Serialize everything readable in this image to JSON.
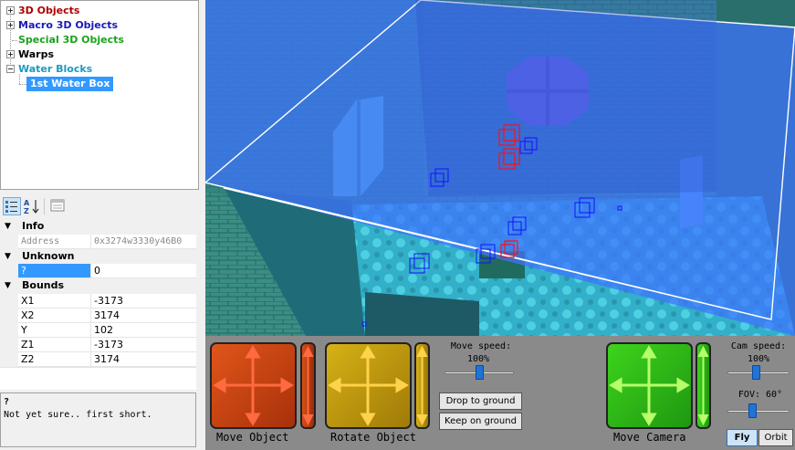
{
  "tree": {
    "items": [
      {
        "label": "3D Objects",
        "color": "#b00000",
        "expander": "plus"
      },
      {
        "label": "Macro 3D Objects",
        "color": "#1a1ab8",
        "expander": "plus"
      },
      {
        "label": "Special 3D Objects",
        "color": "#1aa31a",
        "expander": "none"
      },
      {
        "label": "Warps",
        "color": "#000000",
        "expander": "plus"
      },
      {
        "label": "Water Blocks",
        "color": "#1a9bbf",
        "expander": "minus"
      }
    ],
    "selected_child": "1st Water Box"
  },
  "toolbar": {
    "icons": [
      "categorized-icon",
      "alphabetical-sort-icon",
      "property-pages-icon"
    ]
  },
  "properties": {
    "info": {
      "title": "Info",
      "address_label": "Address",
      "address_value": "0x3274w3330y46B0"
    },
    "unknown": {
      "title": "Unknown",
      "field_label": "?",
      "field_value": "0"
    },
    "bounds": {
      "title": "Bounds",
      "rows": [
        {
          "name": "X1",
          "value": "-3173"
        },
        {
          "name": "X2",
          "value": "3174"
        },
        {
          "name": "Y",
          "value": "102"
        },
        {
          "name": "Z1",
          "value": "-3173"
        },
        {
          "name": "Z2",
          "value": "3174"
        }
      ]
    }
  },
  "description": {
    "title": "?",
    "text": "Not yet sure.. first short."
  },
  "controls": {
    "move_object_label": "Move Object",
    "rotate_object_label": "Rotate Object",
    "move_camera_label": "Move Camera",
    "move_speed_label": "Move speed:",
    "move_speed_value": "100%",
    "move_speed_level": 0.5,
    "drop_to_ground": "Drop to ground",
    "keep_on_ground": "Keep on ground",
    "cam_speed_label": "Cam speed:",
    "cam_speed_value": "100%",
    "cam_speed_level": 0.45,
    "fov_label": "FOV: 60°",
    "fov_level": 0.4,
    "fly_button": "Fly",
    "orbit_button": "Orbit",
    "mode": "Fly"
  },
  "colors": {
    "move_object": "#c8430f",
    "rotate_object": "#c9a20d",
    "move_camera": "#2bb816",
    "selection": "#3399ff",
    "water_plane": "#3f73ff"
  }
}
